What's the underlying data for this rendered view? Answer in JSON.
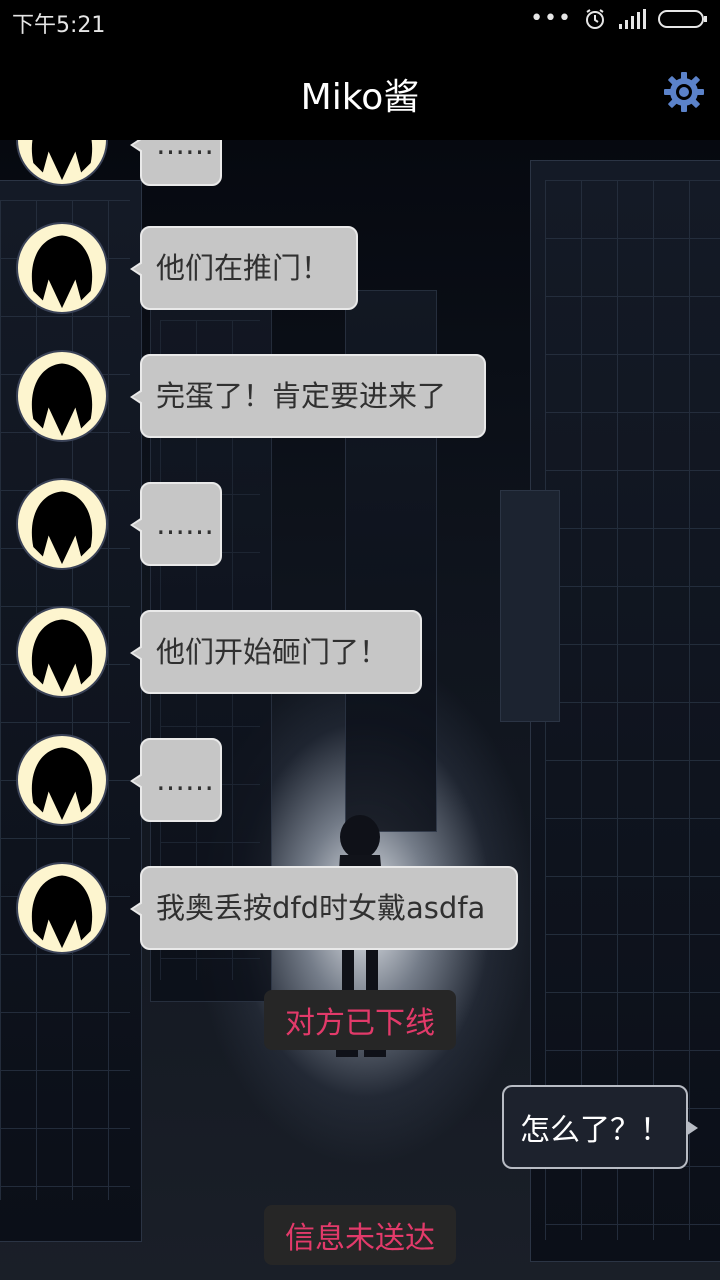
{
  "status_bar": {
    "time": "下午5:21",
    "dots": "•••",
    "icons": [
      "alarm-icon",
      "signal-icon",
      "battery-icon"
    ]
  },
  "header": {
    "title": "Miko酱",
    "settings_icon": "gear-icon"
  },
  "messages": [
    {
      "from": "other",
      "text": "……"
    },
    {
      "from": "other",
      "text": "他们在推门！"
    },
    {
      "from": "other",
      "text": "完蛋了！肯定要进来了"
    },
    {
      "from": "other",
      "text": "……"
    },
    {
      "from": "other",
      "text": "他们开始砸门了！"
    },
    {
      "from": "other",
      "text": "……"
    },
    {
      "from": "other",
      "text": "我奥丢按dfd时女戴asdfa"
    }
  ],
  "system_notices": {
    "offline": "对方已下线",
    "undelivered": "信息未送达"
  },
  "my_message": {
    "from": "me",
    "text": "怎么了？！"
  },
  "colors": {
    "header_bg": "#000000",
    "gear": "#5b82c9",
    "bubble_other": "#c6c6c6",
    "bubble_me": "#1d222d",
    "system_text": "#e23a6a",
    "system_bg": "#262626"
  }
}
